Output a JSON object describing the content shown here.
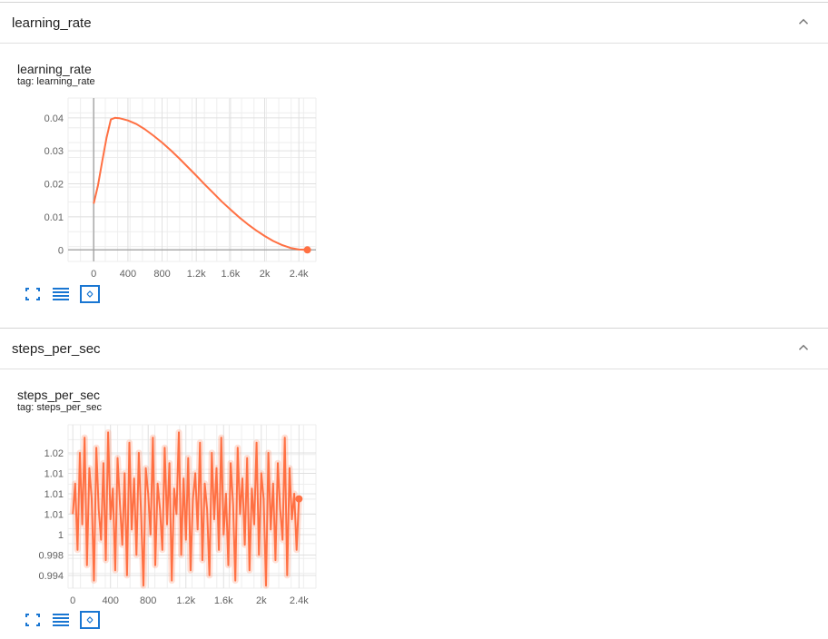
{
  "sections": [
    {
      "title": "learning_rate",
      "card": {
        "title": "learning_rate",
        "tag": "tag: learning_rate",
        "chart_data": {
          "type": "line",
          "title": "learning_rate",
          "xlabel": "",
          "ylabel": "",
          "xlim": [
            -300,
            2600
          ],
          "ylim": [
            -0.0035,
            0.046
          ],
          "x_ticks": [
            0,
            400,
            800,
            1200,
            1600,
            2000,
            2400
          ],
          "x_tick_labels": [
            "0",
            "400",
            "800",
            "1.2k",
            "1.6k",
            "2k",
            "2.4k"
          ],
          "y_ticks": [
            0,
            0.01,
            0.02,
            0.03,
            0.04
          ],
          "y_tick_labels": [
            "0",
            "0.01",
            "0.02",
            "0.03",
            "0.04"
          ],
          "grid": true,
          "series": [
            {
              "color": "#ff7043",
              "x": [
                0,
                50,
                100,
                150,
                200,
                250,
                300,
                400,
                500,
                600,
                700,
                800,
                900,
                1000,
                1100,
                1200,
                1300,
                1400,
                1500,
                1600,
                1700,
                1800,
                1900,
                2000,
                2100,
                2200,
                2300,
                2400,
                2500
              ],
              "y": [
                0.014,
                0.0195,
                0.027,
                0.034,
                0.0395,
                0.04,
                0.0399,
                0.0392,
                0.0381,
                0.0365,
                0.0346,
                0.0325,
                0.0302,
                0.0277,
                0.0251,
                0.0225,
                0.0198,
                0.0172,
                0.0146,
                0.0122,
                0.0099,
                0.0078,
                0.0059,
                0.0042,
                0.0027,
                0.0015,
                0.0006,
                0.0001,
                0.0
              ]
            }
          ]
        }
      }
    },
    {
      "title": "steps_per_sec",
      "card": {
        "title": "steps_per_sec",
        "tag": "tag: steps_per_sec",
        "chart_data": {
          "type": "line",
          "title": "steps_per_sec",
          "xlabel": "",
          "ylabel": "",
          "xlim": [
            -50,
            2580
          ],
          "ylim": [
            0.9915,
            1.0235
          ],
          "x_ticks": [
            0,
            400,
            800,
            1200,
            1600,
            2000,
            2400
          ],
          "x_tick_labels": [
            "0",
            "400",
            "800",
            "1.2k",
            "1.6k",
            "2k",
            "2.4k"
          ],
          "y_ticks": [
            0.994,
            0.998,
            1.002,
            1.006,
            1.01,
            1.014,
            1.018
          ],
          "y_tick_labels": [
            "0.994",
            "0.998",
            "1",
            "1.01",
            "1.01",
            "1.01",
            "1.02"
          ],
          "grid": true,
          "series": [
            {
              "color": "#ff7043",
              "x_start": 0,
              "x_step": 25,
              "y": [
                1.006,
                1.012,
                0.999,
                1.018,
                1.004,
                1.021,
                0.996,
                1.015,
                1.009,
                0.993,
                1.019,
                1.007,
                1.001,
                1.016,
                0.997,
                1.022,
                1.005,
                1.011,
                0.995,
                1.017,
                1.008,
                1.0,
                1.014,
                0.994,
                1.02,
                1.003,
                1.013,
                0.998,
                1.018,
                1.006,
                0.992,
                1.015,
                1.01,
                1.002,
                1.021,
                0.996,
                1.012,
                1.007,
                0.999,
                1.019,
                1.004,
                1.016,
                0.993,
                1.011,
                1.006,
                1.022,
                0.998,
                1.013,
                1.001,
                1.017,
                0.995,
                1.009,
                1.014,
                1.003,
                1.02,
                0.997,
                1.012,
                1.007,
                0.994,
                1.018,
                1.005,
                1.015,
                0.999,
                1.021,
                1.002,
                1.01,
                0.996,
                1.016,
                1.008,
                0.993,
                1.019,
                1.006,
                1.013,
                1.0,
                1.017,
                0.995,
                1.011,
                1.004,
                1.02,
                0.998,
                1.014,
                1.009,
                0.992,
                1.018,
                1.003,
                1.012,
                0.997,
                1.016,
                1.007,
                1.001,
                1.021,
                0.994,
                1.015,
                1.005,
                1.01,
                0.999,
                1.009
              ]
            }
          ]
        }
      }
    }
  ],
  "toolbar": {
    "icons": [
      "fullscreen-icon",
      "toggle-log-scale-icon",
      "fit-domain-icon"
    ]
  },
  "colors": {
    "accent": "#1976d2",
    "series": "#ff7043",
    "grid": "#e0e0e0",
    "axis": "#9e9e9e",
    "text": "#212121",
    "tick_text": "#616161"
  }
}
